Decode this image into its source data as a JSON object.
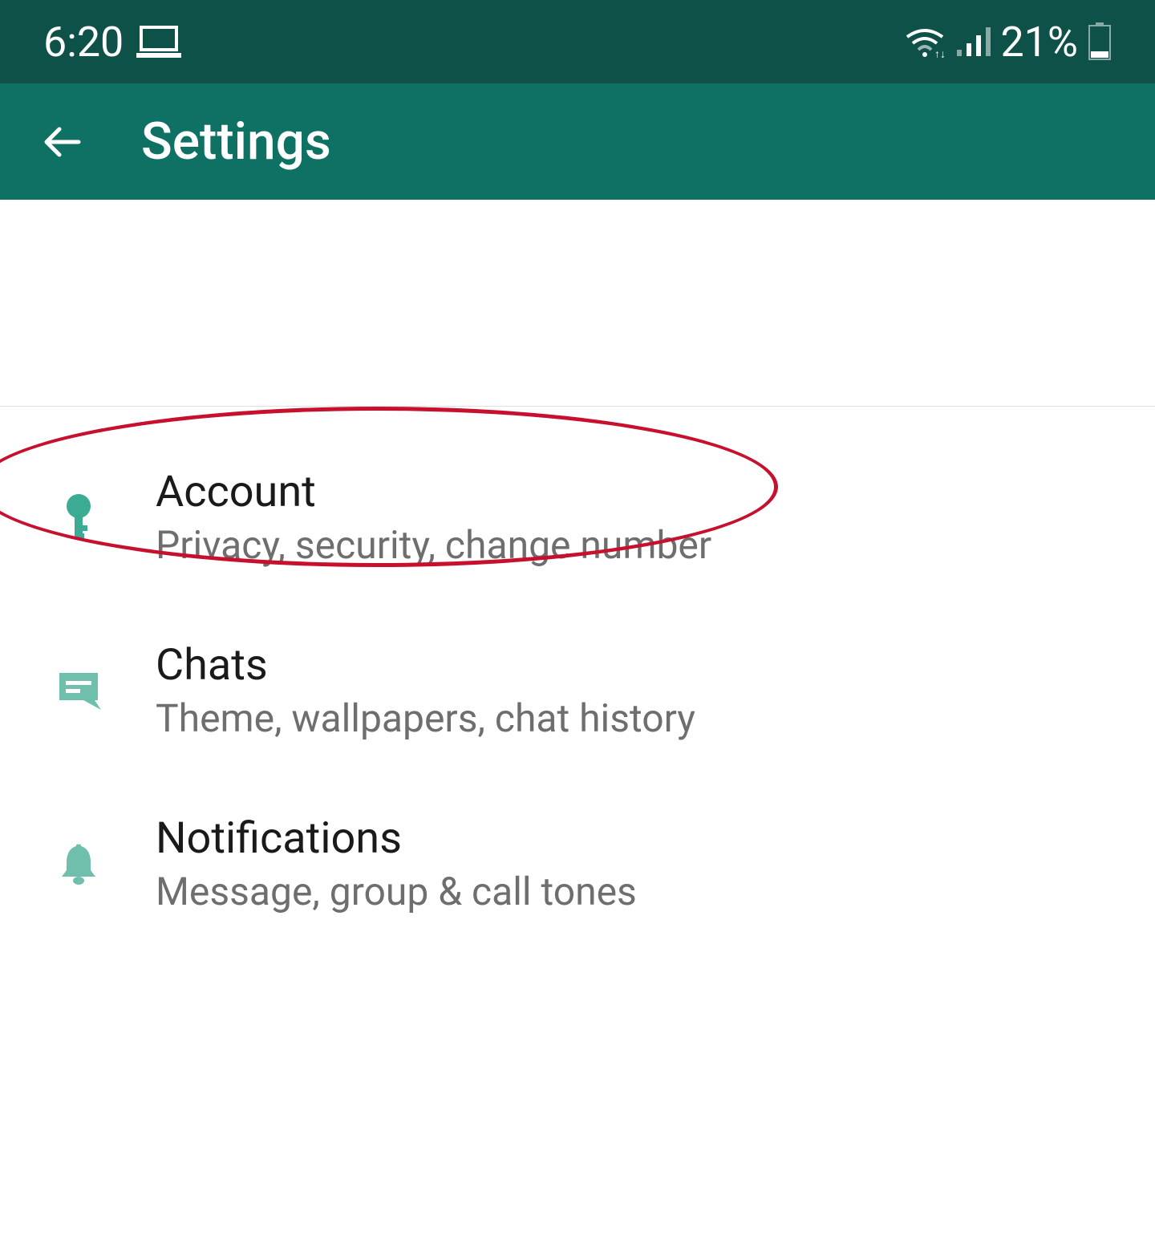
{
  "statusBar": {
    "time": "6:20",
    "batteryPercent": "21%"
  },
  "appBar": {
    "title": "Settings"
  },
  "settings": {
    "items": [
      {
        "title": "Account",
        "subtitle": "Privacy, security, change number"
      },
      {
        "title": "Chats",
        "subtitle": "Theme, wallpapers, chat history"
      },
      {
        "title": "Notifications",
        "subtitle": "Message, group & call tones"
      }
    ]
  }
}
